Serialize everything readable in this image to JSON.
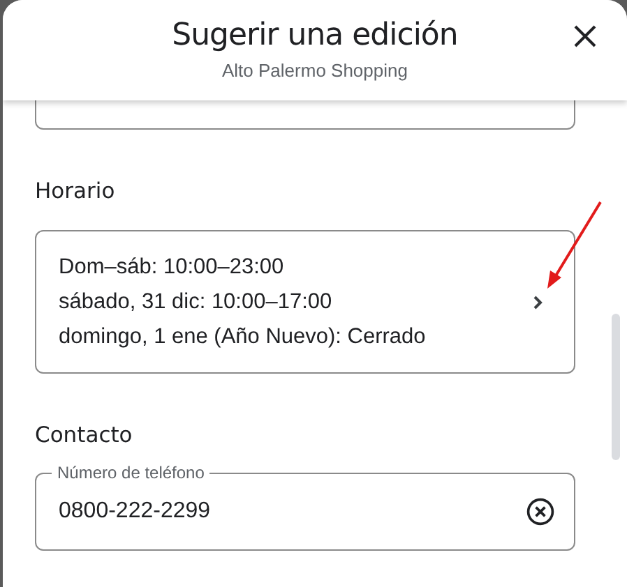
{
  "dialog": {
    "title": "Sugerir una edición",
    "subtitle": "Alto Palermo Shopping"
  },
  "sections": [
    {
      "kind": "hours",
      "heading": "Horario",
      "lines": [
        "Dom–sáb: 10:00–23:00",
        "sábado, 31 dic: 10:00–17:00",
        "domingo, 1 ene (Año Nuevo): Cerrado"
      ]
    },
    {
      "kind": "field",
      "heading": "Contacto",
      "label": "Número de teléfono",
      "value": "0800-222-2299"
    }
  ]
}
